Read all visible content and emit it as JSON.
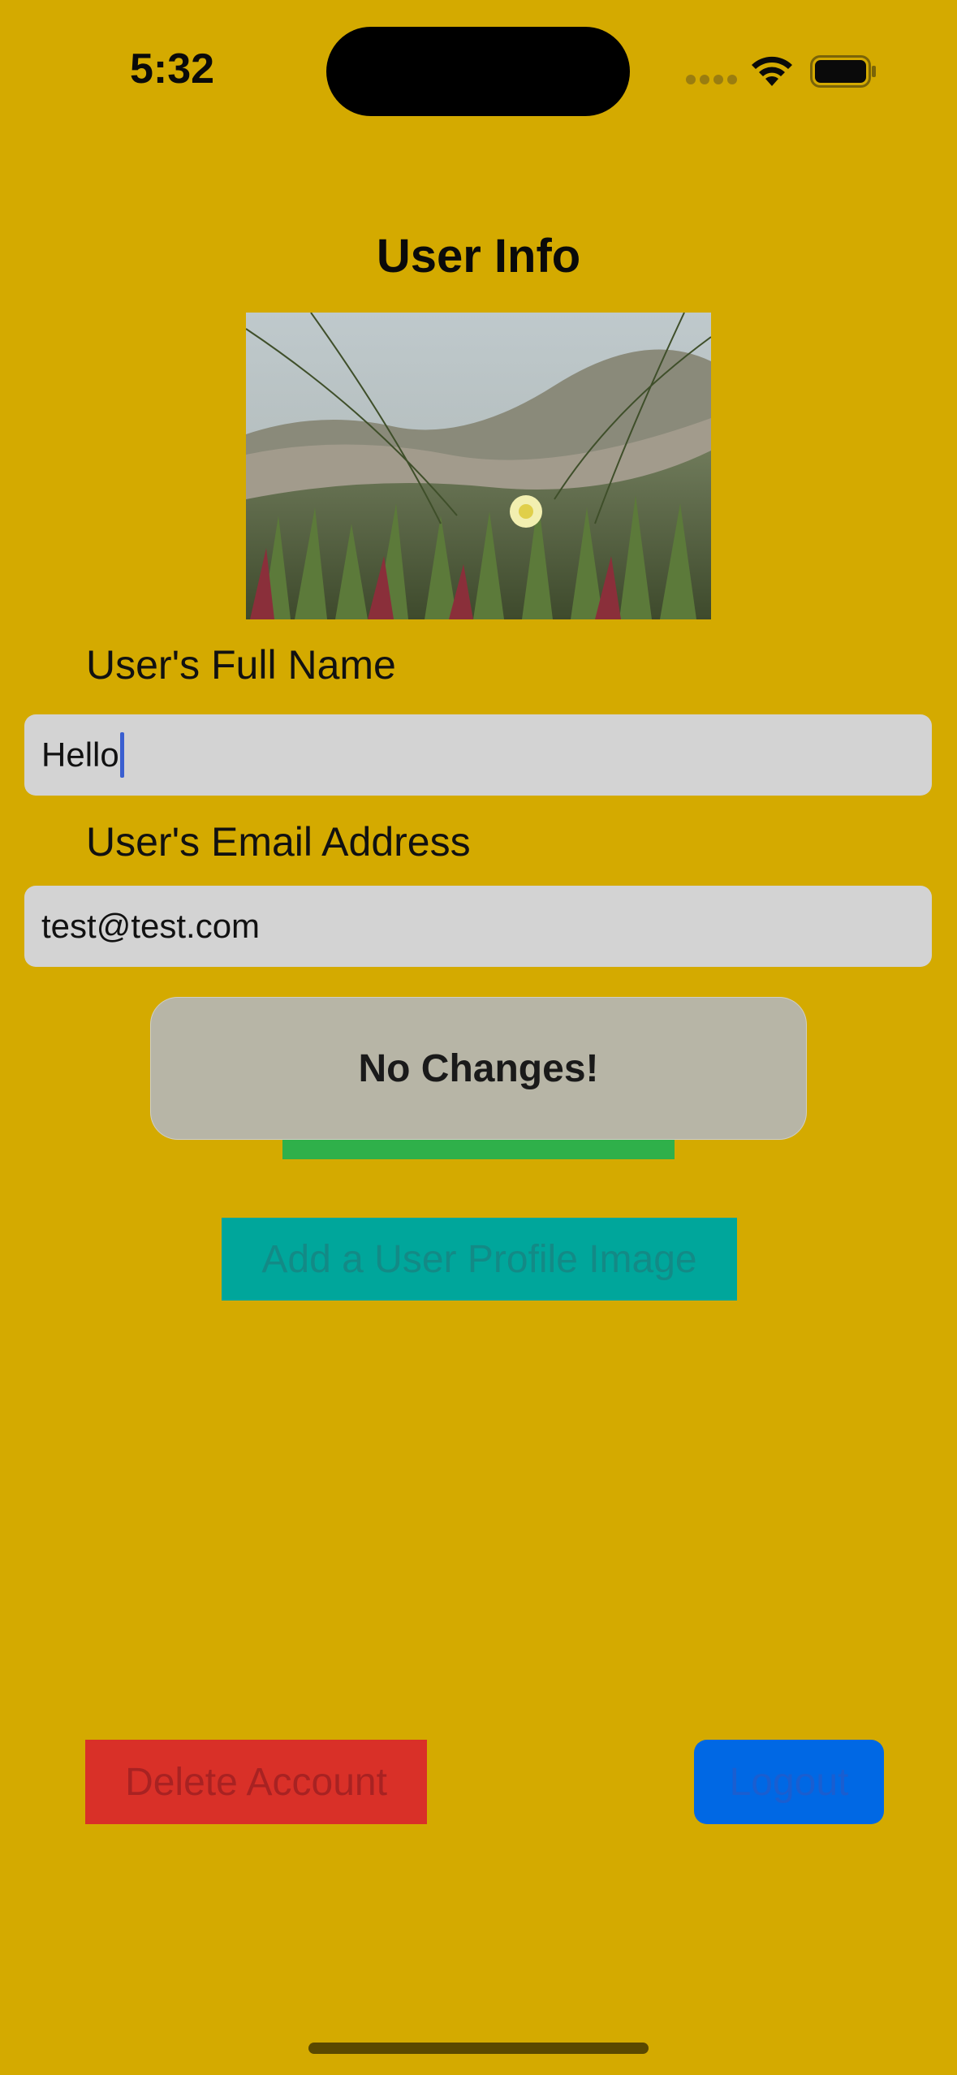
{
  "status_bar": {
    "time": "5:32",
    "icons": [
      "cellular-signal-icon",
      "wifi-icon",
      "battery-icon"
    ]
  },
  "page": {
    "title": "User Info",
    "background_color": "#d4aa00"
  },
  "profile_image": {
    "description": "profile-photo",
    "alt": "User profile photo"
  },
  "form": {
    "full_name_label": "User's Full Name",
    "full_name_value": "Hello",
    "email_label": "User's Email Address",
    "email_value": "test@test.com"
  },
  "toast": {
    "message": "No Changes!"
  },
  "buttons": {
    "add_image_label": "Add a User Profile Image",
    "delete_label": "Delete Account",
    "logout_label": "Logout"
  },
  "colors": {
    "save_button": "#2fb04a",
    "add_image_button": "#00a69b",
    "delete_button": "#d93028",
    "logout_button": "#0068e4"
  }
}
